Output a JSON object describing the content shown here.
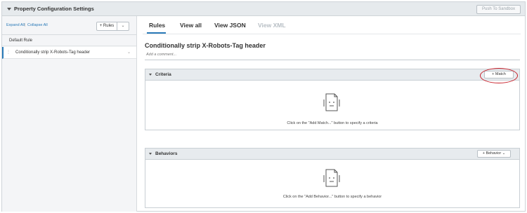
{
  "header": {
    "title": "Property Configuration Settings",
    "push_label": "Push To Sandbox"
  },
  "sidebar": {
    "expand_all": "Expand All",
    "separator": "|",
    "collapse_all": "Collapse All",
    "rules_button": "+ Rules",
    "rules_dropdown": "⌄",
    "default_rule": "Default Rule",
    "selected_rule": "Conditionally strip X-Robots-Tag header",
    "drag_glyph": "⋮",
    "chevron": "⌄"
  },
  "tabs": [
    {
      "label": "Rules",
      "active": true
    },
    {
      "label": "View all",
      "active": false
    },
    {
      "label": "View JSON",
      "active": false
    },
    {
      "label": "View XML",
      "active": false,
      "disabled": true
    }
  ],
  "main": {
    "rule_title": "Conditionally strip X-Robots-Tag header",
    "comment_placeholder": "Add a comment..."
  },
  "criteria": {
    "title": "Criteria",
    "button": "+ Match",
    "hint": "Click on the \"Add Match...\" button to specify a criteria"
  },
  "behaviors": {
    "title": "Behaviors",
    "button": "+ Behavior ⌄",
    "hint": "Click on the \"Add Behavior...\" button to specify a behavior"
  },
  "colors": {
    "accent": "#2a7ab8",
    "annotation": "#c8202a",
    "header_bg": "#e6eaed"
  }
}
